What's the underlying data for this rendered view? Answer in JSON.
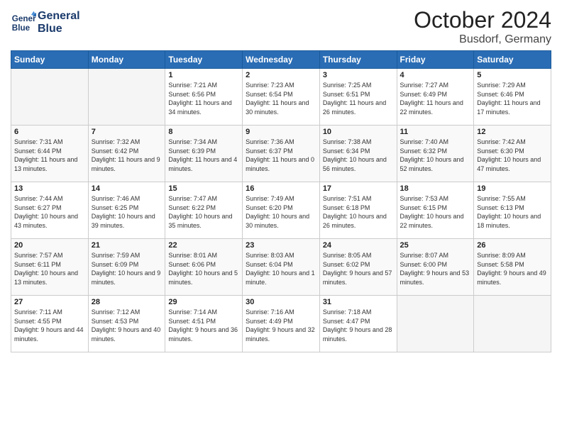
{
  "header": {
    "logo_line1": "General",
    "logo_line2": "Blue",
    "month": "October 2024",
    "location": "Busdorf, Germany"
  },
  "weekdays": [
    "Sunday",
    "Monday",
    "Tuesday",
    "Wednesday",
    "Thursday",
    "Friday",
    "Saturday"
  ],
  "weeks": [
    [
      {
        "day": "",
        "empty": true
      },
      {
        "day": "",
        "empty": true
      },
      {
        "day": "1",
        "sunrise": "7:21 AM",
        "sunset": "6:56 PM",
        "daylight": "11 hours and 34 minutes."
      },
      {
        "day": "2",
        "sunrise": "7:23 AM",
        "sunset": "6:54 PM",
        "daylight": "11 hours and 30 minutes."
      },
      {
        "day": "3",
        "sunrise": "7:25 AM",
        "sunset": "6:51 PM",
        "daylight": "11 hours and 26 minutes."
      },
      {
        "day": "4",
        "sunrise": "7:27 AM",
        "sunset": "6:49 PM",
        "daylight": "11 hours and 22 minutes."
      },
      {
        "day": "5",
        "sunrise": "7:29 AM",
        "sunset": "6:46 PM",
        "daylight": "11 hours and 17 minutes."
      }
    ],
    [
      {
        "day": "6",
        "sunrise": "7:31 AM",
        "sunset": "6:44 PM",
        "daylight": "11 hours and 13 minutes."
      },
      {
        "day": "7",
        "sunrise": "7:32 AM",
        "sunset": "6:42 PM",
        "daylight": "11 hours and 9 minutes."
      },
      {
        "day": "8",
        "sunrise": "7:34 AM",
        "sunset": "6:39 PM",
        "daylight": "11 hours and 4 minutes."
      },
      {
        "day": "9",
        "sunrise": "7:36 AM",
        "sunset": "6:37 PM",
        "daylight": "11 hours and 0 minutes."
      },
      {
        "day": "10",
        "sunrise": "7:38 AM",
        "sunset": "6:34 PM",
        "daylight": "10 hours and 56 minutes."
      },
      {
        "day": "11",
        "sunrise": "7:40 AM",
        "sunset": "6:32 PM",
        "daylight": "10 hours and 52 minutes."
      },
      {
        "day": "12",
        "sunrise": "7:42 AM",
        "sunset": "6:30 PM",
        "daylight": "10 hours and 47 minutes."
      }
    ],
    [
      {
        "day": "13",
        "sunrise": "7:44 AM",
        "sunset": "6:27 PM",
        "daylight": "10 hours and 43 minutes."
      },
      {
        "day": "14",
        "sunrise": "7:46 AM",
        "sunset": "6:25 PM",
        "daylight": "10 hours and 39 minutes."
      },
      {
        "day": "15",
        "sunrise": "7:47 AM",
        "sunset": "6:22 PM",
        "daylight": "10 hours and 35 minutes."
      },
      {
        "day": "16",
        "sunrise": "7:49 AM",
        "sunset": "6:20 PM",
        "daylight": "10 hours and 30 minutes."
      },
      {
        "day": "17",
        "sunrise": "7:51 AM",
        "sunset": "6:18 PM",
        "daylight": "10 hours and 26 minutes."
      },
      {
        "day": "18",
        "sunrise": "7:53 AM",
        "sunset": "6:15 PM",
        "daylight": "10 hours and 22 minutes."
      },
      {
        "day": "19",
        "sunrise": "7:55 AM",
        "sunset": "6:13 PM",
        "daylight": "10 hours and 18 minutes."
      }
    ],
    [
      {
        "day": "20",
        "sunrise": "7:57 AM",
        "sunset": "6:11 PM",
        "daylight": "10 hours and 13 minutes."
      },
      {
        "day": "21",
        "sunrise": "7:59 AM",
        "sunset": "6:09 PM",
        "daylight": "10 hours and 9 minutes."
      },
      {
        "day": "22",
        "sunrise": "8:01 AM",
        "sunset": "6:06 PM",
        "daylight": "10 hours and 5 minutes."
      },
      {
        "day": "23",
        "sunrise": "8:03 AM",
        "sunset": "6:04 PM",
        "daylight": "10 hours and 1 minute."
      },
      {
        "day": "24",
        "sunrise": "8:05 AM",
        "sunset": "6:02 PM",
        "daylight": "9 hours and 57 minutes."
      },
      {
        "day": "25",
        "sunrise": "8:07 AM",
        "sunset": "6:00 PM",
        "daylight": "9 hours and 53 minutes."
      },
      {
        "day": "26",
        "sunrise": "8:09 AM",
        "sunset": "5:58 PM",
        "daylight": "9 hours and 49 minutes."
      }
    ],
    [
      {
        "day": "27",
        "sunrise": "7:11 AM",
        "sunset": "4:55 PM",
        "daylight": "9 hours and 44 minutes."
      },
      {
        "day": "28",
        "sunrise": "7:12 AM",
        "sunset": "4:53 PM",
        "daylight": "9 hours and 40 minutes."
      },
      {
        "day": "29",
        "sunrise": "7:14 AM",
        "sunset": "4:51 PM",
        "daylight": "9 hours and 36 minutes."
      },
      {
        "day": "30",
        "sunrise": "7:16 AM",
        "sunset": "4:49 PM",
        "daylight": "9 hours and 32 minutes."
      },
      {
        "day": "31",
        "sunrise": "7:18 AM",
        "sunset": "4:47 PM",
        "daylight": "9 hours and 28 minutes."
      },
      {
        "day": "",
        "empty": true
      },
      {
        "day": "",
        "empty": true
      }
    ]
  ]
}
